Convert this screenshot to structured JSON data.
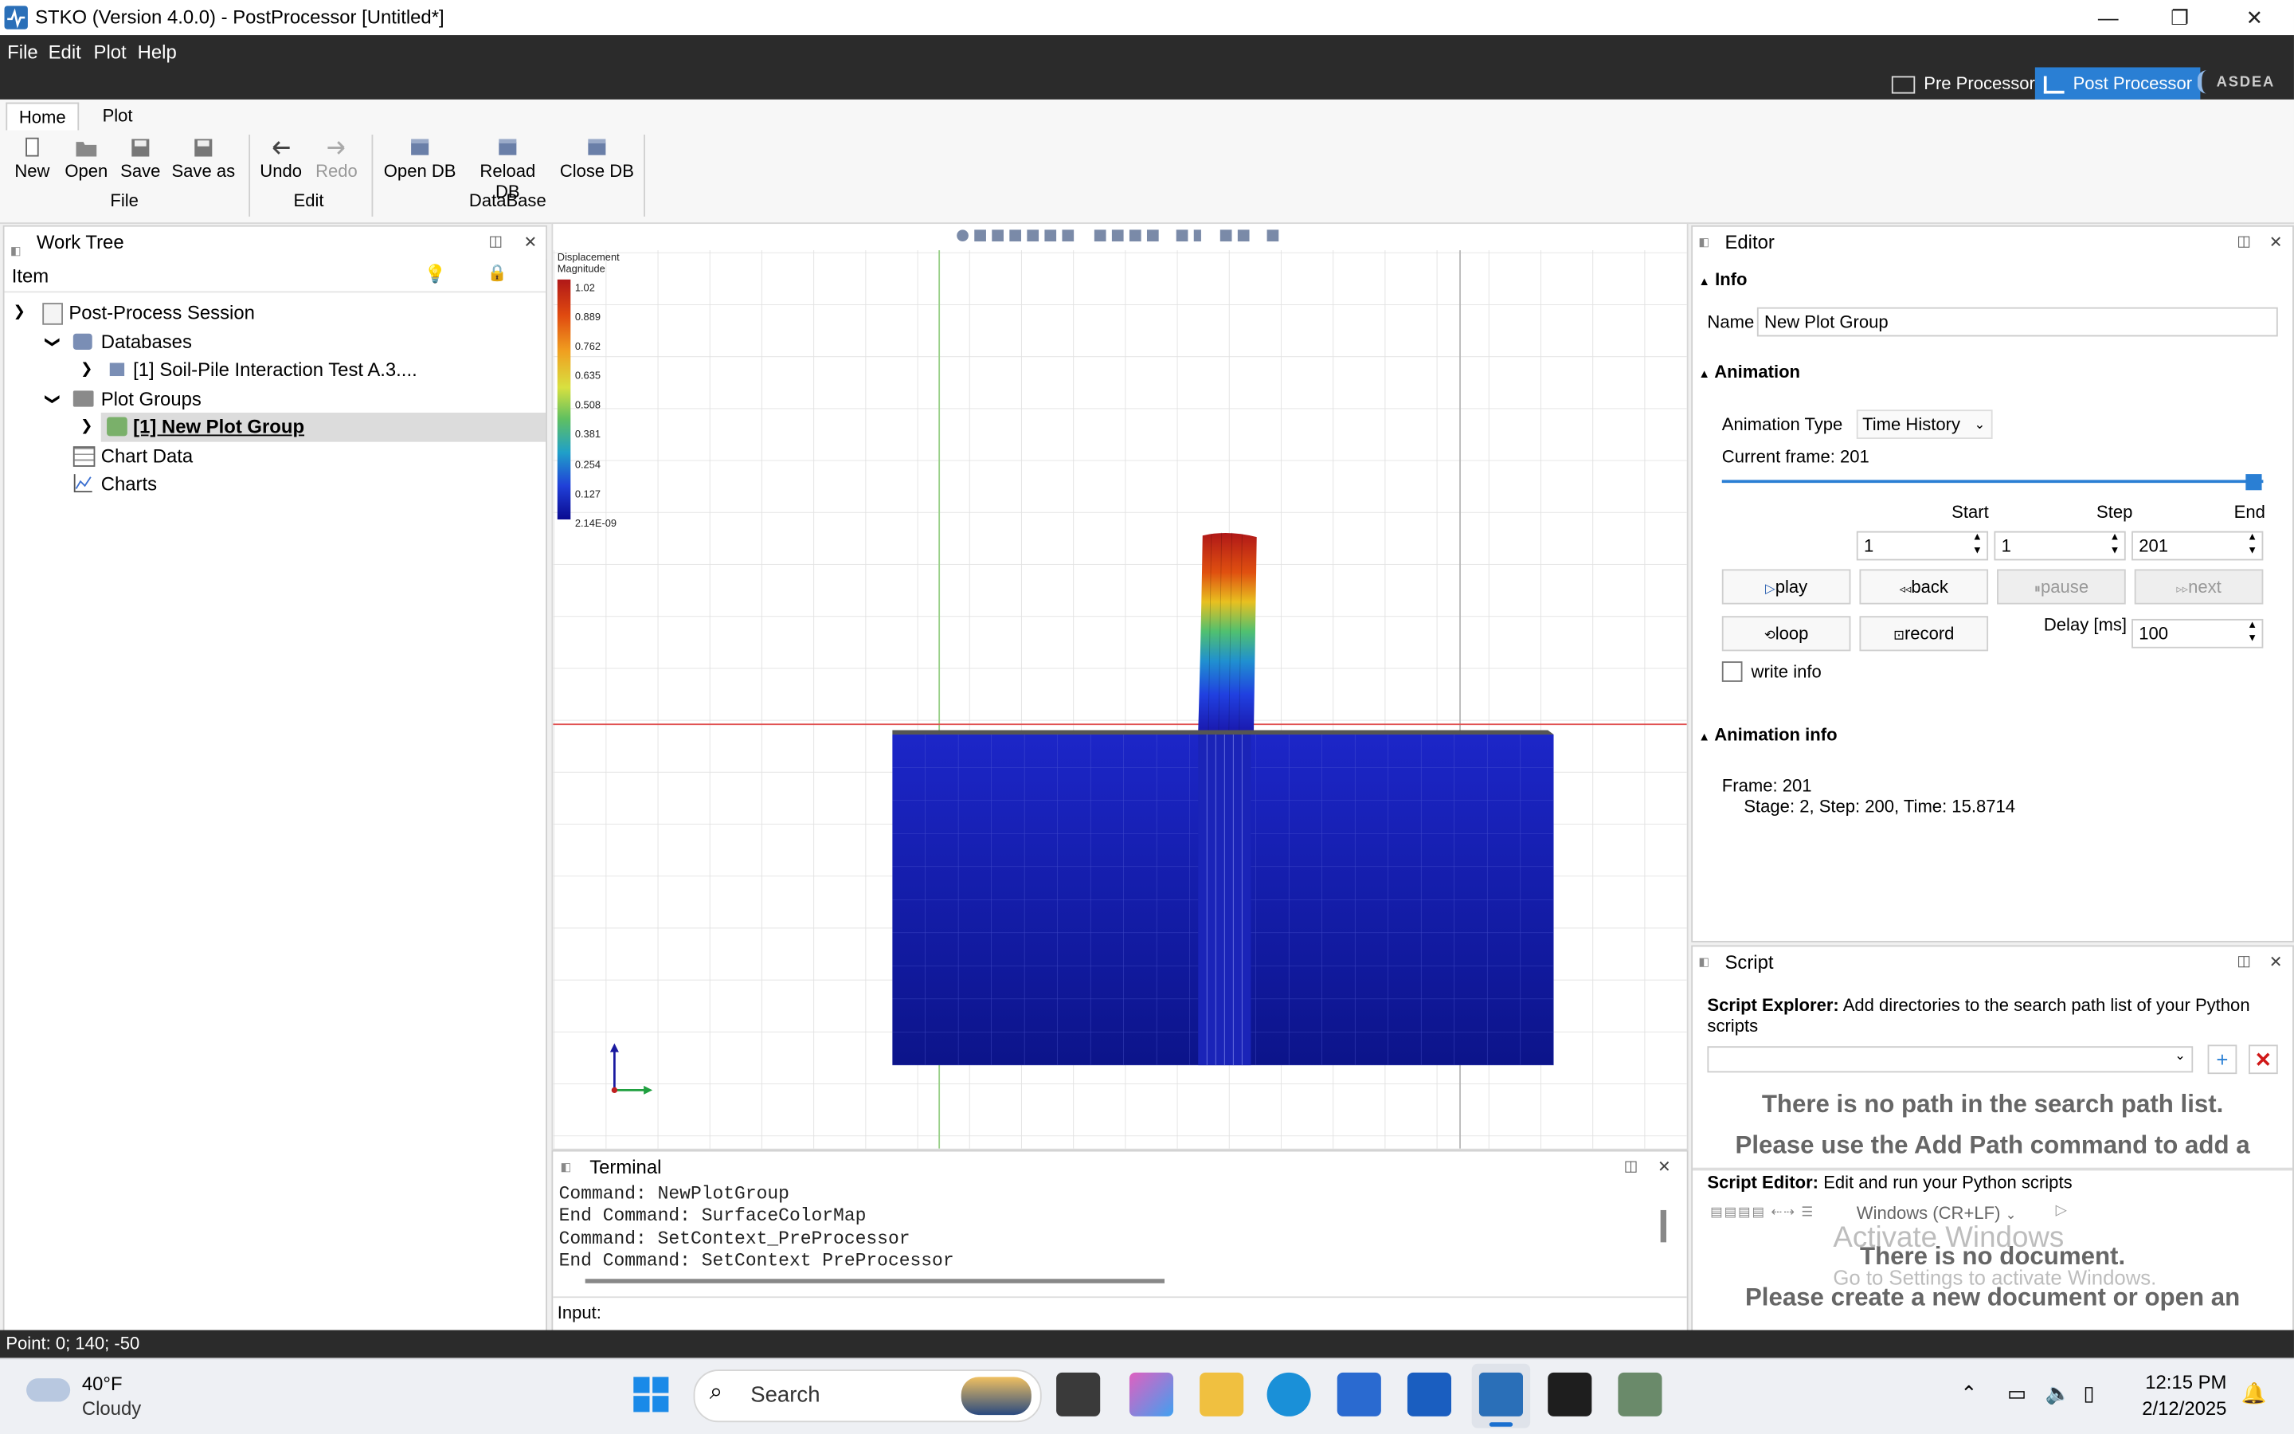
{
  "window": {
    "title": "STKO (Version 4.0.0) - PostProcessor [Untitled*]"
  },
  "menubar": {
    "items": [
      "File",
      "Edit",
      "Plot",
      "Help"
    ]
  },
  "modes": {
    "pre": "Pre Processor",
    "post": "Post Processor",
    "brand": "ASDEA"
  },
  "ribbon": {
    "tabs": [
      "Home",
      "Plot"
    ],
    "buttons": [
      "New",
      "Open",
      "Save",
      "Save as",
      "Undo",
      "Redo",
      "Open DB",
      "Reload DB",
      "Close DB"
    ],
    "groups": [
      "File",
      "Edit",
      "DataBase"
    ]
  },
  "worktree": {
    "title": "Work Tree",
    "column": "Item",
    "items": [
      "Post-Process Session",
      "Databases",
      "[1] Soil-Pile Interaction Test A.3....",
      "Plot Groups",
      "[1] New Plot Group",
      "Chart Data",
      "Charts"
    ]
  },
  "viewport": {
    "legend_title": "Displacement Magnitude",
    "legend_ticks": [
      "1.02",
      "0.889",
      "0.762",
      "0.635",
      "0.508",
      "0.381",
      "0.254",
      "0.127",
      "2.14E-09"
    ]
  },
  "editor": {
    "title": "Editor",
    "info_header": "Info",
    "name_label": "Name",
    "name_value": "New Plot Group",
    "animation_header": "Animation",
    "anim_type_label": "Animation Type",
    "anim_type_value": "Time History",
    "current_frame": "Current frame: 201",
    "frame_progress": 1.0,
    "start_label": "Start",
    "step_label": "Step",
    "end_label": "End",
    "start_value": "1",
    "step_value": "1",
    "end_value": "201",
    "play": "play",
    "back": "back",
    "pause": "pause",
    "next": "next",
    "loop": "loop",
    "record": "record",
    "delay_label": "Delay [ms]",
    "delay_value": "100",
    "write_info": "write info",
    "anim_info_header": "Animation info",
    "frame_info": "Frame: 201",
    "stage_info": "Stage: 2, Step: 200, Time: 15.8714"
  },
  "script": {
    "title": "Script",
    "explorer_label": "Script Explorer:",
    "explorer_desc": "Add directories to the search path list of your Python scripts",
    "no_path_1": "There is no path in the search path list.",
    "no_path_2": "Please use the Add Path command to add a",
    "editor_label": "Script Editor:",
    "editor_desc": "Edit and run your Python scripts",
    "line_ending": "Windows (CR+LF)",
    "no_doc_1": "There is no document.",
    "no_doc_2": "Please create a new document or open an",
    "watermark_1": "Activate Windows",
    "watermark_2": "Go to Settings to activate Windows."
  },
  "terminal": {
    "title": "Terminal",
    "lines": [
      "Command: NewPlotGroup",
      "End Command: SurfaceColorMap",
      "Command: SetContext_PreProcessor",
      "End Command: SetContext PreProcessor"
    ],
    "input_label": "Input:"
  },
  "statusbar": {
    "text": "Point: 0; 140; -50"
  },
  "taskbar": {
    "weather_temp": "40°F",
    "weather_desc": "Cloudy",
    "search": "Search",
    "time": "12:15 PM",
    "date": "2/12/2025"
  }
}
